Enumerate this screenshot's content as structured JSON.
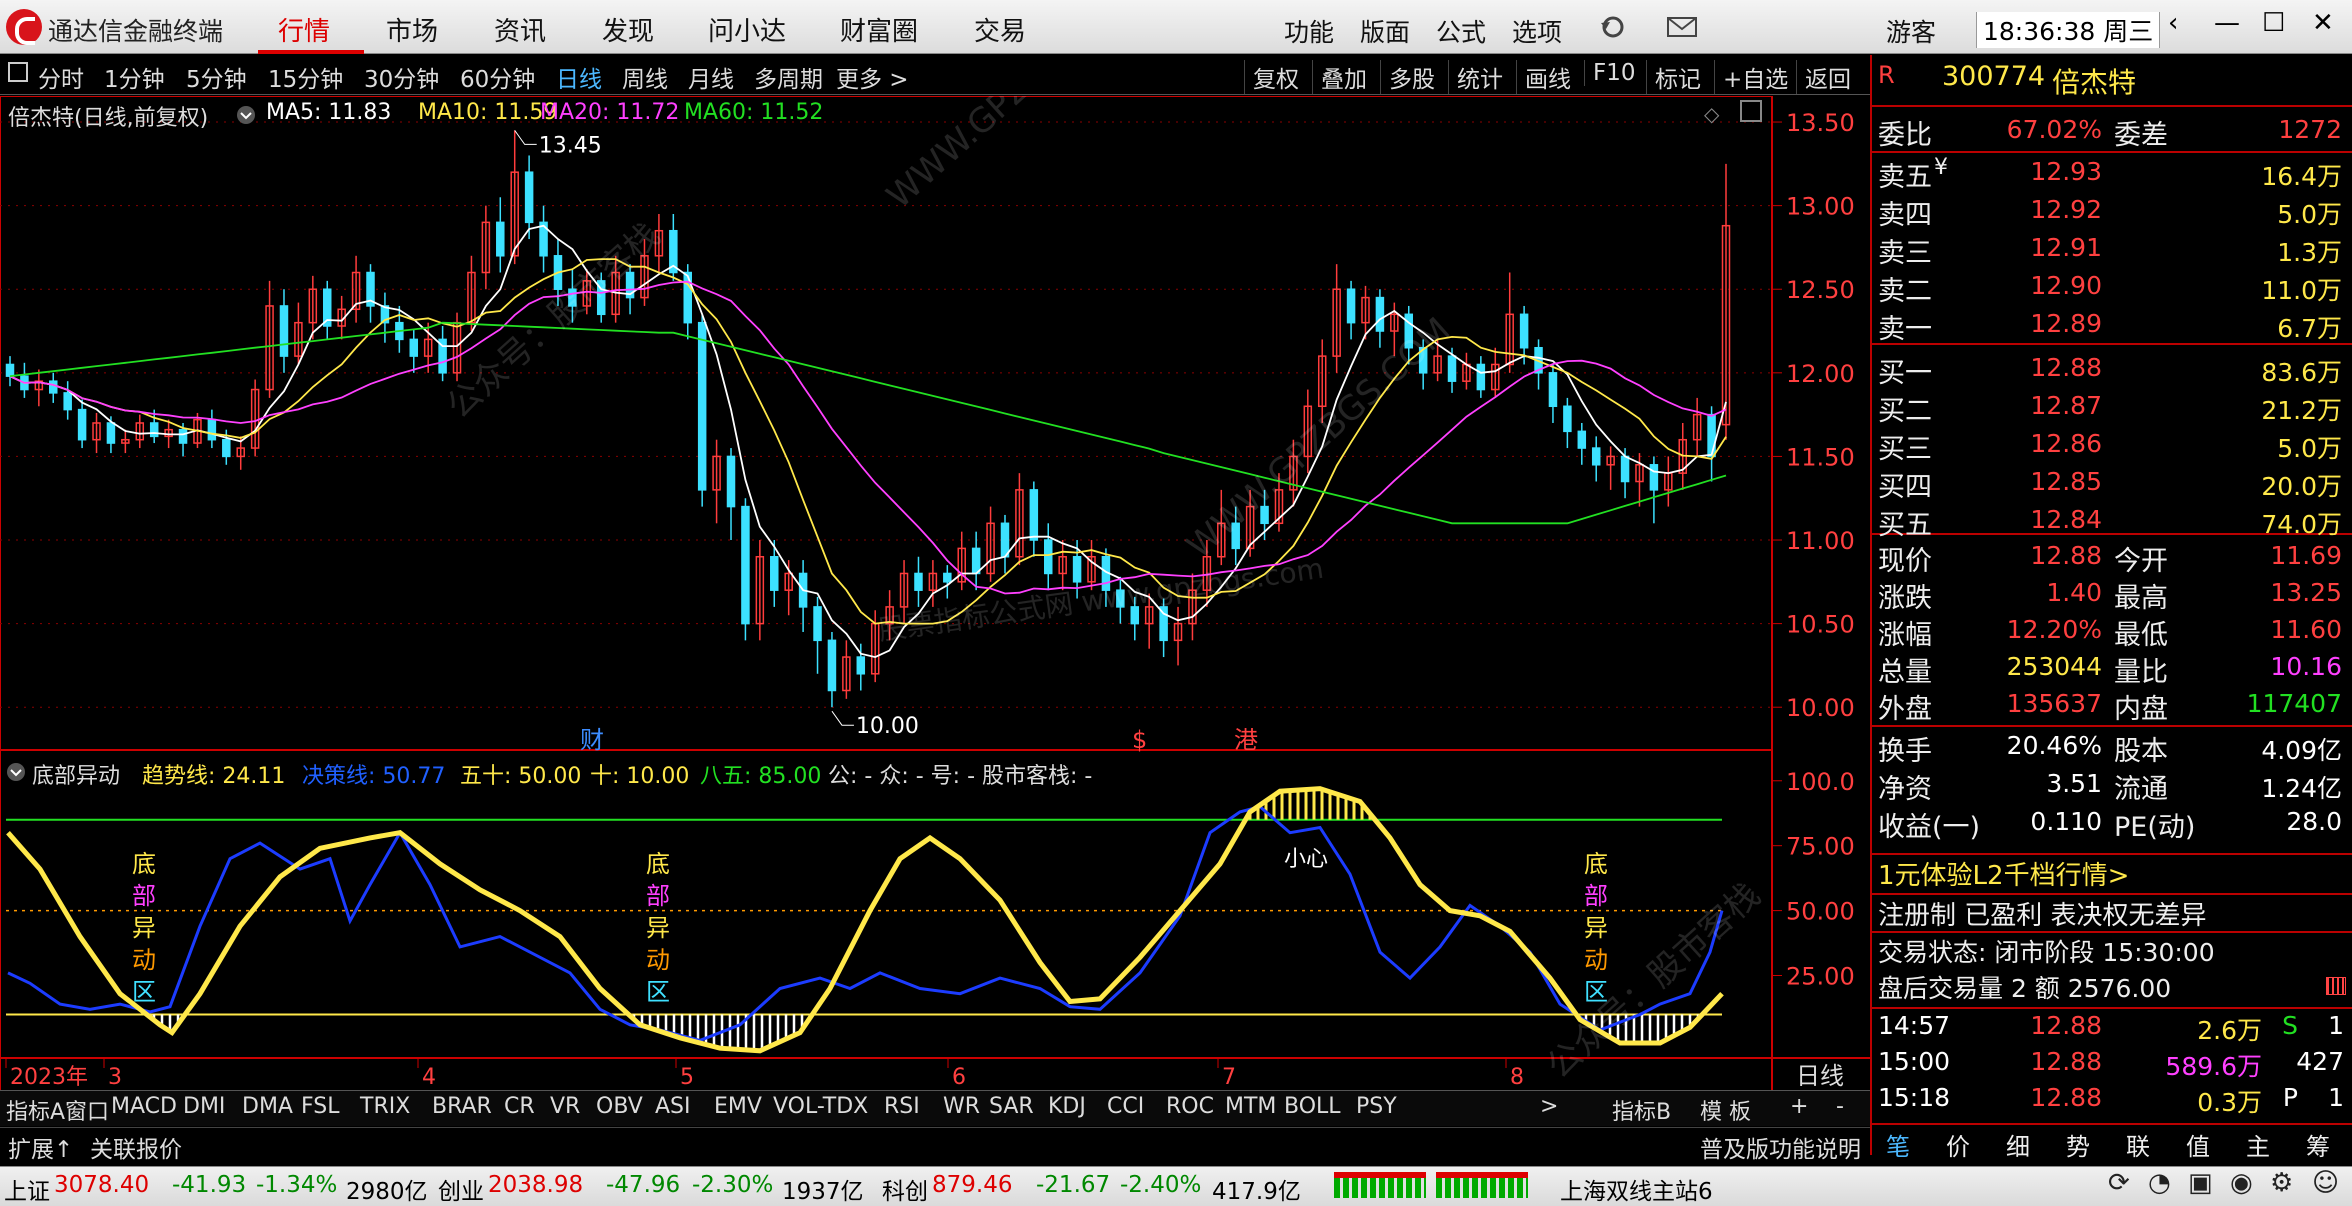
{
  "app": {
    "title": "通达信金融终端",
    "nav": [
      "行情",
      "市场",
      "资讯",
      "发现",
      "问小达",
      "财富圈",
      "交易"
    ],
    "active_nav": "行情",
    "funcs": [
      "功能",
      "版面",
      "公式",
      "选项"
    ],
    "user": "游客",
    "clock": "18:36:38 周三"
  },
  "periods": [
    "分时",
    "1分钟",
    "5分钟",
    "15分钟",
    "30分钟",
    "60分钟",
    "日线",
    "周线",
    "月线",
    "多周期",
    "更多 >"
  ],
  "active_period": "日线",
  "right_btns": [
    "复权",
    "叠加",
    "多股",
    "统计",
    "画线",
    "F10",
    "标记",
    "+自选",
    "返回"
  ],
  "chart": {
    "name": "倍杰特(日线,前复权)",
    "ma5": "MA5: 11.83",
    "ma10": "MA10: 11.59",
    "ma20": "MA20: 11.72",
    "ma60": "MA60: 11.52",
    "hi_label": "13.45",
    "lo_label": "10.00",
    "marks": [
      "财",
      "$",
      "港"
    ],
    "yticks": [
      "13.50",
      "13.00",
      "12.50",
      "12.00",
      "11.50",
      "11.00",
      "10.50",
      "10.00"
    ],
    "months": [
      "2023年",
      "3",
      "4",
      "5",
      "6",
      "7",
      "8"
    ],
    "period_tag": "日线"
  },
  "indicator": {
    "name": "底部异动",
    "trend": "趋势线: 24.11",
    "decision": "决策线: 50.77",
    "fifty": "五十: 50.00",
    "ten": "十: 10.00",
    "eightyfive": "八五: 85.00",
    "misc": "公: - 众: - 号: - 股市客栈: -",
    "yticks": [
      "100.0",
      "75.00",
      "50.00",
      "25.00"
    ],
    "signal_chars": [
      "底",
      "部",
      "异",
      "动",
      "区"
    ],
    "caution": "小心"
  },
  "ind_tabs": [
    "指标A",
    "窗口",
    "MACD",
    "DMI",
    "DMA",
    "FSL",
    "TRIX",
    "BRAR",
    "CR",
    "VR",
    "OBV",
    "ASI",
    "EMV",
    "VOL-TDX",
    "SAR",
    "KDJ",
    "CCI",
    "ROC",
    "MTM",
    "BOLL",
    "PSY",
    ">",
    "指标B",
    "模 板",
    "+",
    "-"
  ],
  "ind_tabs_fix": [
    "指标A",
    "窗口",
    "MACD",
    "DMI",
    "DMA",
    "FSL",
    "TRIX",
    "BRAR",
    "CR",
    "VR",
    "OBV",
    "ASI",
    "EMV",
    "VOL-TDX",
    "RSI",
    "WR",
    "SAR",
    "KDJ",
    "CCI",
    "ROC",
    "MTM",
    "BOLL",
    "PSY"
  ],
  "extra": {
    "expand": "扩展↑",
    "related": "关联报价",
    "help": "普及版功能说明"
  },
  "quote": {
    "code": "300774",
    "name": "倍杰特",
    "weibi_l": "委比",
    "weibi": "67.02%",
    "weicha_l": "委差",
    "weicha": "1272",
    "asks": [
      {
        "l": "卖五",
        "y": "¥",
        "p": "12.93",
        "v": "16.4万"
      },
      {
        "l": "卖四",
        "p": "12.92",
        "v": "5.0万"
      },
      {
        "l": "卖三",
        "p": "12.91",
        "v": "1.3万"
      },
      {
        "l": "卖二",
        "p": "12.90",
        "v": "11.0万"
      },
      {
        "l": "卖一",
        "p": "12.89",
        "v": "6.7万"
      }
    ],
    "bids": [
      {
        "l": "买一",
        "p": "12.88",
        "v": "83.6万"
      },
      {
        "l": "买二",
        "p": "12.87",
        "v": "21.2万"
      },
      {
        "l": "买三",
        "p": "12.86",
        "v": "5.0万"
      },
      {
        "l": "买四",
        "p": "12.85",
        "v": "20.0万"
      },
      {
        "l": "买五",
        "p": "12.84",
        "v": "74.0万"
      }
    ],
    "stats": [
      [
        "现价",
        "12.88",
        "今开",
        "11.69"
      ],
      [
        "涨跌",
        "1.40",
        "最高",
        "13.25"
      ],
      [
        "涨幅",
        "12.20%",
        "最低",
        "11.60"
      ],
      [
        "总量",
        "253044",
        "量比",
        "10.16"
      ],
      [
        "外盘",
        "135637",
        "内盘",
        "117407"
      ]
    ],
    "stats2": [
      [
        "换手",
        "20.46%",
        "股本",
        "4.09亿"
      ],
      [
        "净资",
        "3.51",
        "流通",
        "1.24亿"
      ],
      [
        "收益(一)",
        "0.110",
        "PE(动)",
        "28.0"
      ]
    ],
    "l2": "1元体验L2千档行情>",
    "tags": "注册制 已盈利 表决权无差异",
    "trade_state": "交易状态: 闭市阶段 15:30:00",
    "after": "盘后交易量 2 额 2576.00",
    "ticks": [
      {
        "t": "14:57",
        "p": "12.88",
        "v": "2.6万",
        "s": "S",
        "n": "1"
      },
      {
        "t": "15:00",
        "p": "12.88",
        "v": "589.6万",
        "s": "",
        "n": "427"
      },
      {
        "t": "15:18",
        "p": "12.88",
        "v": "0.3万",
        "s": "P",
        "n": "1"
      }
    ],
    "bottom_tabs": [
      "笔",
      "价",
      "细",
      "势",
      "联",
      "值",
      "主",
      "筹"
    ]
  },
  "status": {
    "sh": "上证",
    "sh_v": "3078.40",
    "sh_c": "-41.93",
    "sh_p": "-1.34%",
    "sh_a": "2980亿",
    "cy": "创业",
    "cy_v": "2038.98",
    "cy_c": "-47.96",
    "cy_p": "-2.30%",
    "cy_a": "1937亿",
    "kc": "科创",
    "kc_v": "879.46",
    "kc_c": "-21.67",
    "kc_p": "-2.40%",
    "kc_a": "417.9亿",
    "server": "上海双线主站6"
  },
  "watermark": [
    "公众号：股市客栈",
    "WWW.GPZBGS.COM",
    "股票指标公式网 www.gpzbgs.com"
  ]
}
